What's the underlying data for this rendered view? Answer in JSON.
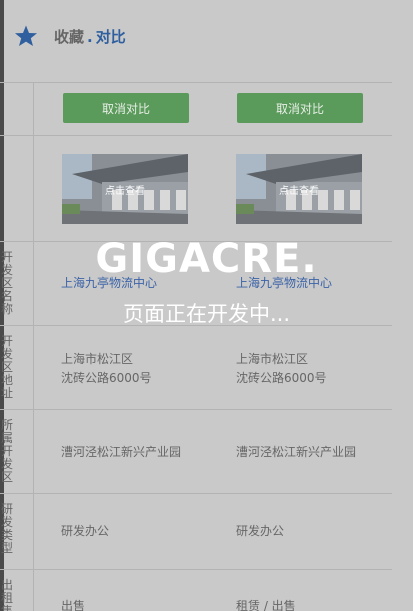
{
  "header": {
    "fav": "收藏",
    "dot": ".",
    "compare": "对比"
  },
  "products": [
    {
      "cancel_label": "取消对比",
      "view_label": "点击查看",
      "name": "上海九亭物流中心",
      "address_line1": "上海市松江区",
      "address_line2": "沈砖公路6000号",
      "park": "漕河泾松江新兴产业园",
      "type": "研发办公",
      "rent": "出售"
    },
    {
      "cancel_label": "取消对比",
      "view_label": "点击查看",
      "name": "上海九亭物流中心",
      "address_line1": "上海市松江区",
      "address_line2": "沈砖公路6000号",
      "park": "漕河泾松江新兴产业园",
      "type": "研发办公",
      "rent": "租赁 / 出售"
    }
  ],
  "row_labels": {
    "name": "开发区名称",
    "address": "开发区地址",
    "park": "所属开发区",
    "type": "研发类型",
    "rent": "出租售"
  },
  "overlay": {
    "logo": "GIGACRE.",
    "message": "页面正在开发中..."
  },
  "colors": {
    "accent_blue": "#2f5f9e",
    "button_green": "#5a9a5a",
    "background": "#c9c9c9"
  }
}
